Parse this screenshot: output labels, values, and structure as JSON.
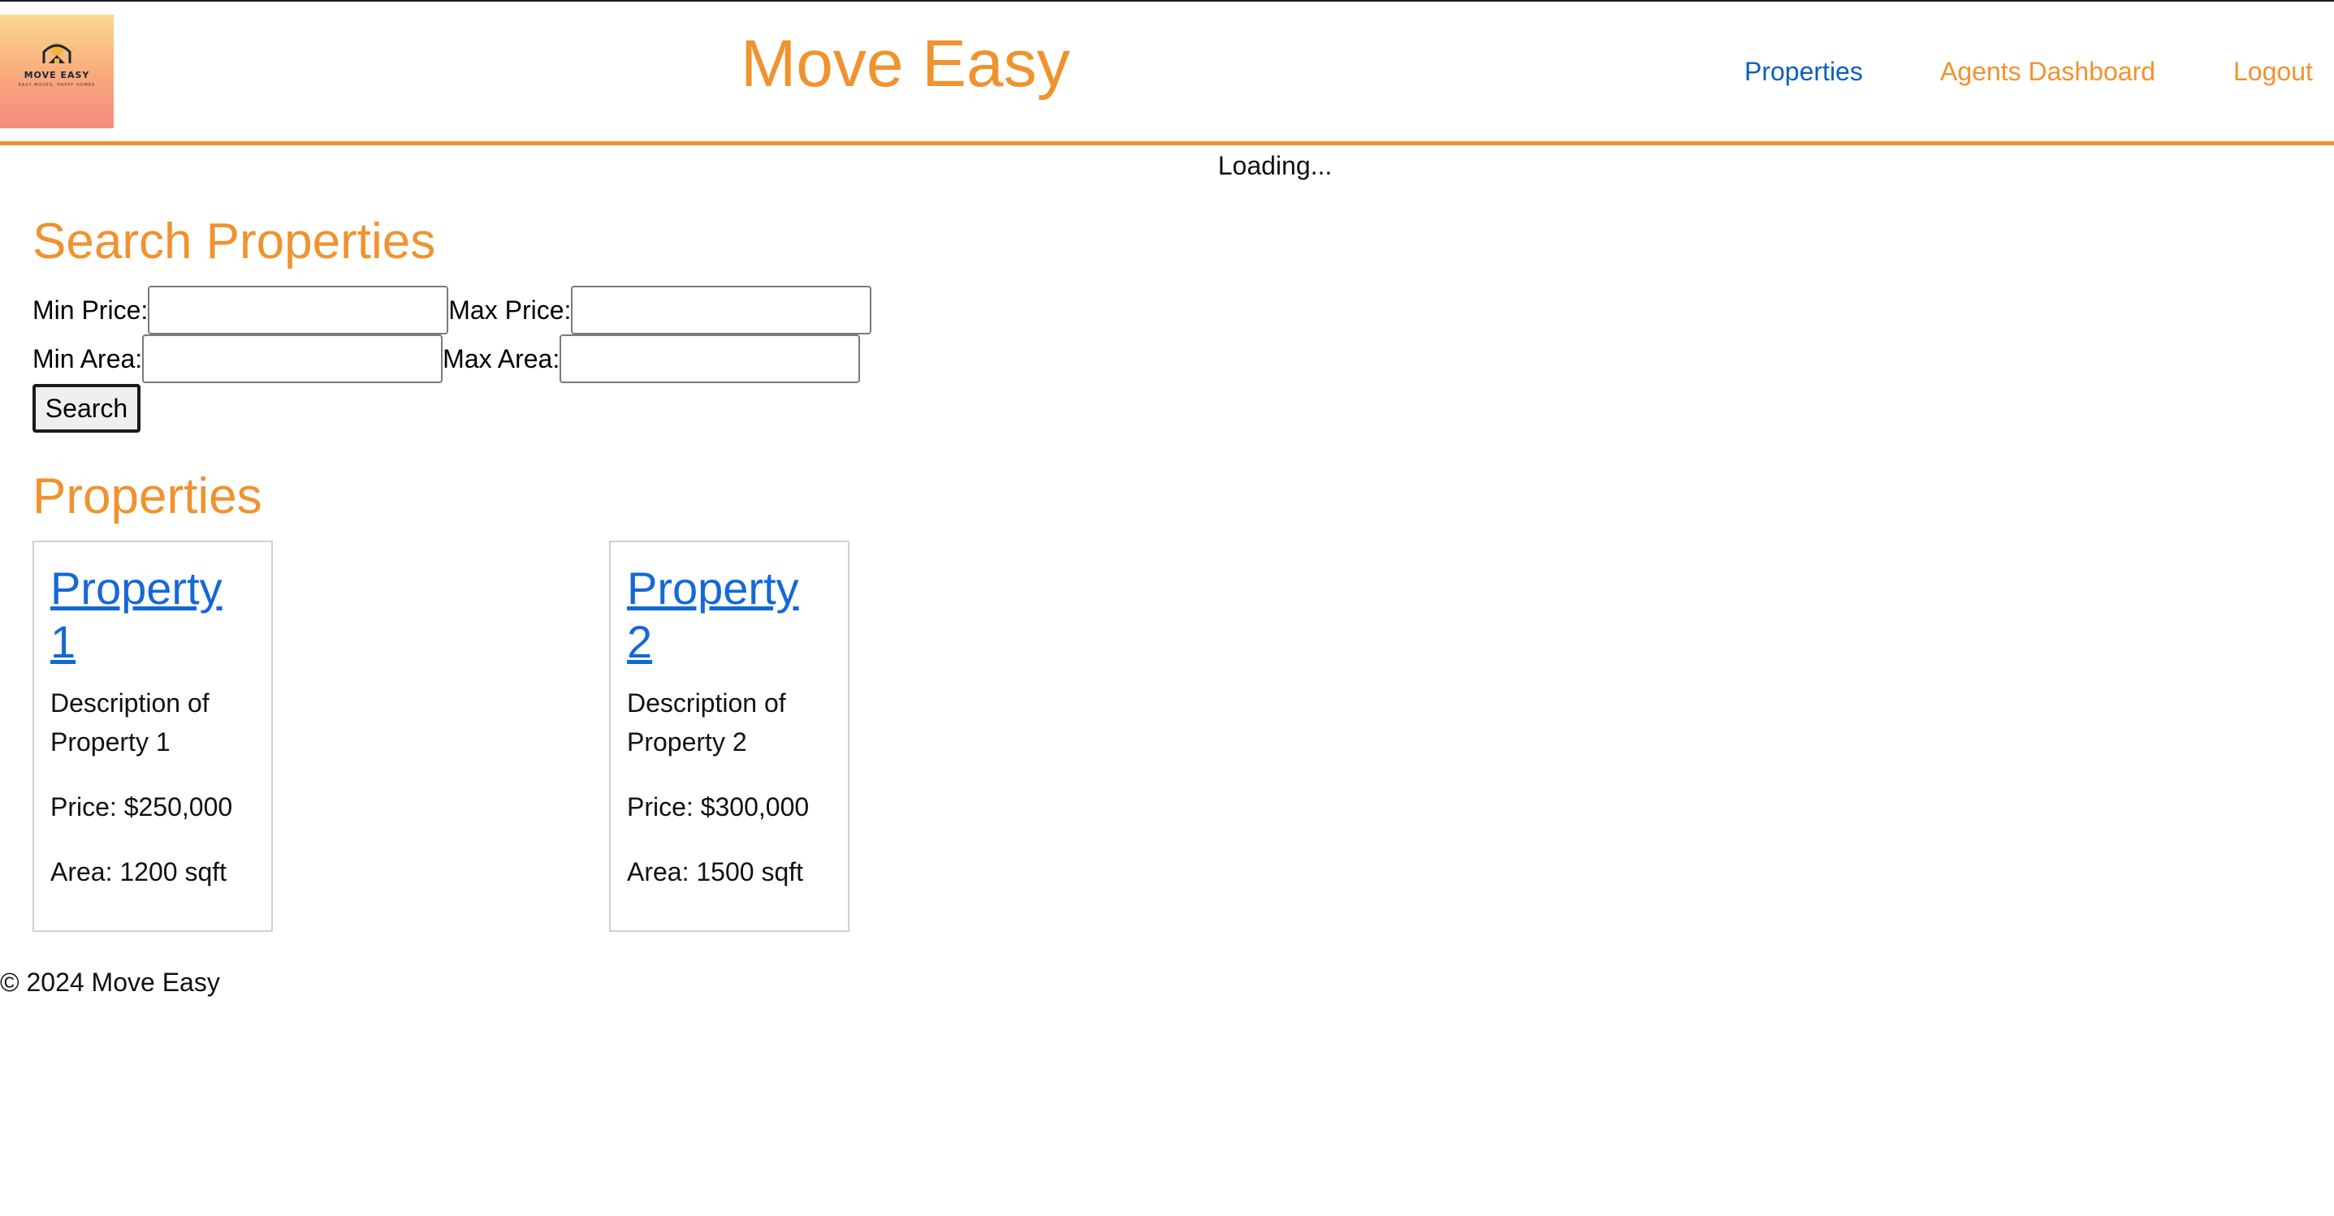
{
  "header": {
    "title": "Move Easy",
    "logo": {
      "name": "MOVE EASY",
      "tagline": "EASY MOVES, HAPPY HOMES",
      "icon": "house-sun-icon"
    },
    "nav": [
      {
        "label": "Properties",
        "active": true
      },
      {
        "label": "Agents Dashboard",
        "active": false
      },
      {
        "label": "Logout",
        "active": false
      }
    ]
  },
  "status": {
    "loading_text": "Loading..."
  },
  "search": {
    "heading": "Search Properties",
    "min_price_label": "Min Price:",
    "max_price_label": "Max Price:",
    "min_area_label": "Min Area:",
    "max_area_label": "Max Area:",
    "min_price_value": "",
    "max_price_value": "",
    "min_area_value": "",
    "max_area_value": "",
    "button_label": "Search"
  },
  "properties": {
    "heading": "Properties",
    "items": [
      {
        "title": "Property 1",
        "description": "Description of Property 1",
        "price": "Price: $250,000",
        "area": "Area: 1200 sqft"
      },
      {
        "title": "Property 2",
        "description": "Description of Property 2",
        "price": "Price: $300,000",
        "area": "Area: 1500 sqft"
      }
    ]
  },
  "footer": {
    "text": "© 2024 Move Easy"
  },
  "colors": {
    "accent": "#f0922e",
    "link_active": "#0a5fc2",
    "property_link": "#1568d6"
  }
}
